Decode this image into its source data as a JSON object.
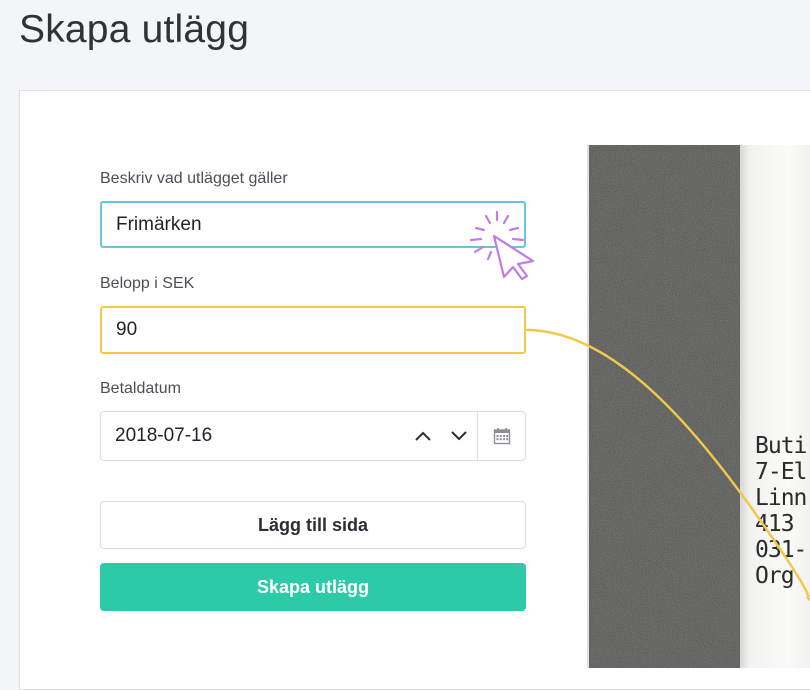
{
  "page": {
    "title": "Skapa utlägg"
  },
  "form": {
    "description_label": "Beskriv vad utlägget gäller",
    "description_value": "Frimärken",
    "amount_label": "Belopp i SEK",
    "amount_value": "90",
    "date_label": "Betaldatum",
    "date_value": "2018-07-16",
    "add_page_label": "Lägg till sida",
    "create_label": "Skapa utlägg"
  },
  "receipt": {
    "lines": [
      "Buti",
      "7-El",
      "Linn",
      "413",
      "031-",
      "Org"
    ]
  },
  "colors": {
    "accent_green": "#2ccaa6",
    "focus_blue": "#6cc3e0",
    "highlight_yellow": "#f1c84a",
    "cursor_purple": "#c27be8"
  },
  "icons": {
    "date_up": "chevron-up-icon",
    "date_down": "chevron-down-icon",
    "calendar": "calendar-icon",
    "cursor": "pointer-click-icon"
  }
}
